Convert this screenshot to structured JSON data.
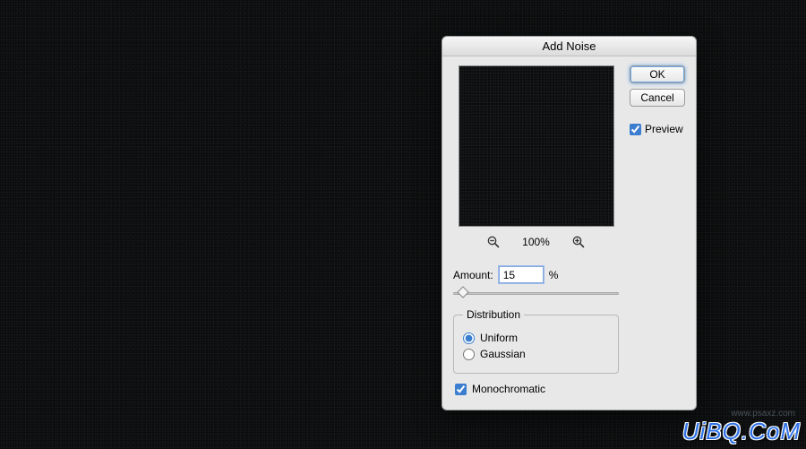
{
  "dialog": {
    "title": "Add Noise",
    "buttons": {
      "ok": "OK",
      "cancel": "Cancel"
    },
    "preview": {
      "label": "Preview",
      "checked": true
    },
    "zoom": {
      "level": "100%"
    },
    "amount": {
      "label": "Amount:",
      "value": "15",
      "unit": "%"
    },
    "distribution": {
      "legend": "Distribution",
      "options": {
        "uniform": "Uniform",
        "gaussian": "Gaussian"
      },
      "selected": "uniform"
    },
    "monochromatic": {
      "label": "Monochromatic",
      "checked": true
    }
  },
  "watermark": {
    "main": "UiBQ.CoM",
    "sub": "www.psaxz.com"
  }
}
